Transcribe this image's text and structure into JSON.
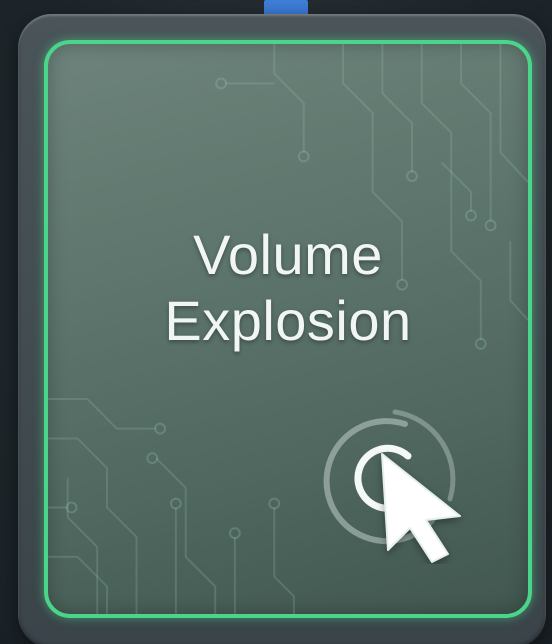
{
  "card": {
    "title_line1": "Volume",
    "title_line2": "Explosion",
    "icon": "cursor-click-icon"
  },
  "colors": {
    "card_border": "#4bd58b",
    "card_fill": "#5e766d",
    "connector": "#3f7fd9",
    "text": "#f1f5f3"
  }
}
